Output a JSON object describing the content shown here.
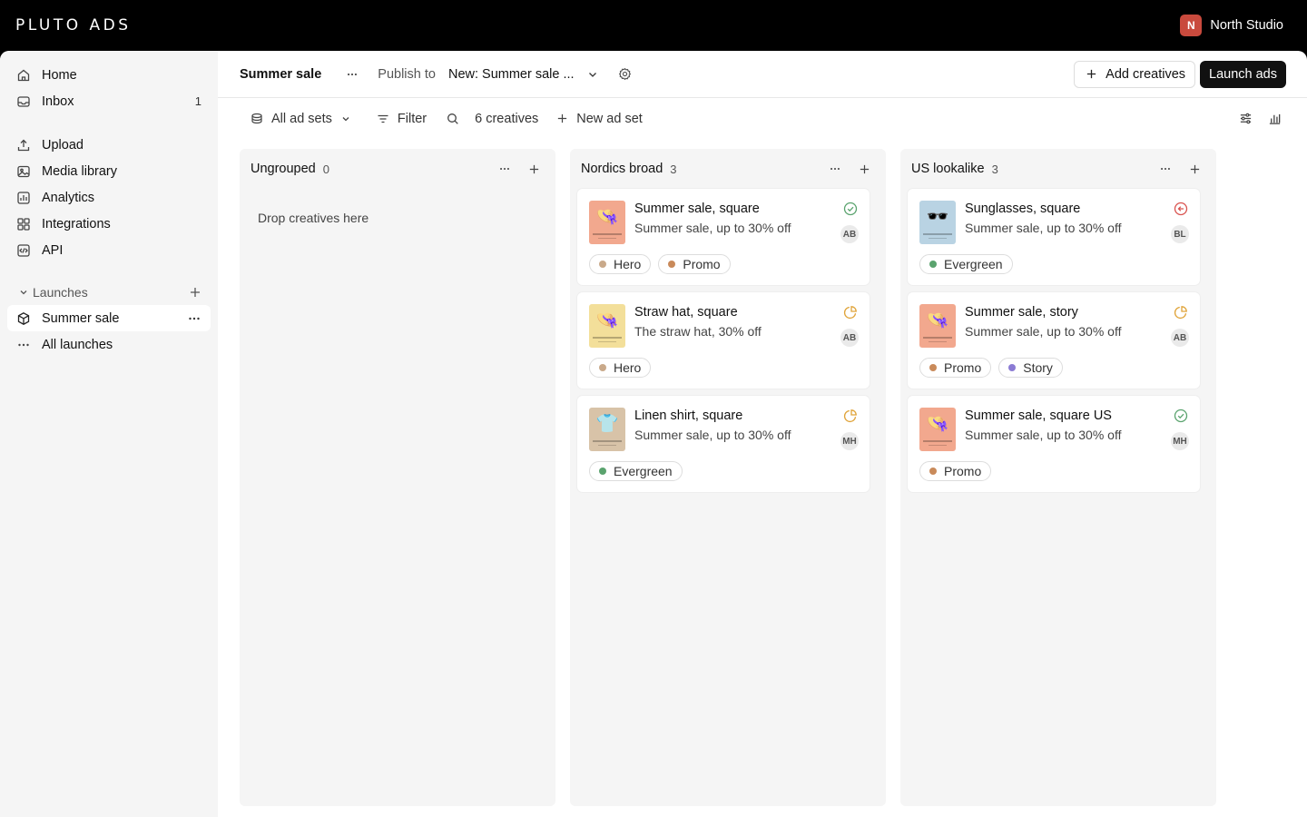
{
  "brand": {
    "logo": "PLUTO ADS"
  },
  "workspace": {
    "initial": "N",
    "name": "North Studio",
    "color": "#c94a3d"
  },
  "sidebar": {
    "nav": [
      {
        "label": "Home",
        "icon": "home-icon"
      },
      {
        "label": "Inbox",
        "icon": "inbox-icon",
        "count": "1"
      },
      {
        "label": "Upload",
        "icon": "upload-icon"
      },
      {
        "label": "Media library",
        "icon": "media-library-icon"
      },
      {
        "label": "Analytics",
        "icon": "analytics-icon"
      },
      {
        "label": "Integrations",
        "icon": "integrations-icon"
      },
      {
        "label": "API",
        "icon": "api-icon"
      }
    ],
    "launches": {
      "label": "Launches",
      "items": [
        {
          "label": "Summer sale",
          "icon": "box-icon",
          "active": true
        },
        {
          "label": "All launches",
          "icon": "more-horizontal-icon"
        }
      ]
    }
  },
  "header": {
    "title": "Summer sale",
    "publish_label": "Publish to",
    "publish_value": "New: Summer sale ...",
    "add_creatives": "Add creatives",
    "launch_ads": "Launch ads"
  },
  "subbar": {
    "adsets": "All ad sets",
    "filter": "Filter",
    "creatives_count": "6 creatives",
    "new_ad_set": "New ad set"
  },
  "columns": [
    {
      "name": "Ungrouped",
      "count": "0",
      "empty_text": "Drop creatives here",
      "cards": []
    },
    {
      "name": "Nordics broad",
      "count": "3",
      "cards": [
        {
          "title": "Summer sale, square",
          "subtitle": "Summer sale, up to 30% off",
          "status": "approved",
          "initials": "AB",
          "thumb_bg": "#f2a88e",
          "thumb_emoji": "👒",
          "tags": [
            {
              "label": "Hero",
              "color": "#c9a98a"
            },
            {
              "label": "Promo",
              "color": "#c98a5a"
            }
          ]
        },
        {
          "title": "Straw hat, square",
          "subtitle": "The straw hat, 30% off",
          "status": "in-progress",
          "initials": "AB",
          "thumb_bg": "#f3df9a",
          "thumb_emoji": "👒",
          "tags": [
            {
              "label": "Hero",
              "color": "#c9a98a"
            }
          ]
        },
        {
          "title": "Linen shirt, square",
          "subtitle": "Summer sale, up to 30% off",
          "status": "in-progress",
          "initials": "MH",
          "thumb_bg": "#d8c3a8",
          "thumb_emoji": "👕",
          "tags": [
            {
              "label": "Evergreen",
              "color": "#5aa36e"
            }
          ]
        }
      ]
    },
    {
      "name": "US lookalike",
      "count": "3",
      "cards": [
        {
          "title": "Sunglasses, square",
          "subtitle": "Summer sale, up to 30% off",
          "status": "returned",
          "initials": "BL",
          "thumb_bg": "#b9d3e3",
          "thumb_emoji": "🕶️",
          "tags": [
            {
              "label": "Evergreen",
              "color": "#5aa36e"
            }
          ]
        },
        {
          "title": "Summer sale, story",
          "subtitle": "Summer sale, up to 30% off",
          "status": "in-progress",
          "initials": "AB",
          "thumb_bg": "#f2a88e",
          "thumb_emoji": "👒",
          "tags": [
            {
              "label": "Promo",
              "color": "#c98a5a"
            },
            {
              "label": "Story",
              "color": "#8b7bd4"
            }
          ]
        },
        {
          "title": "Summer sale, square US",
          "subtitle": "Summer sale, up to 30% off",
          "status": "approved",
          "initials": "MH",
          "thumb_bg": "#f2a88e",
          "thumb_emoji": "👒",
          "tags": [
            {
              "label": "Promo",
              "color": "#c98a5a"
            }
          ]
        }
      ]
    }
  ],
  "status_colors": {
    "approved": "#5aa36e",
    "in-progress": "#e0a43a",
    "returned": "#d9534f"
  }
}
